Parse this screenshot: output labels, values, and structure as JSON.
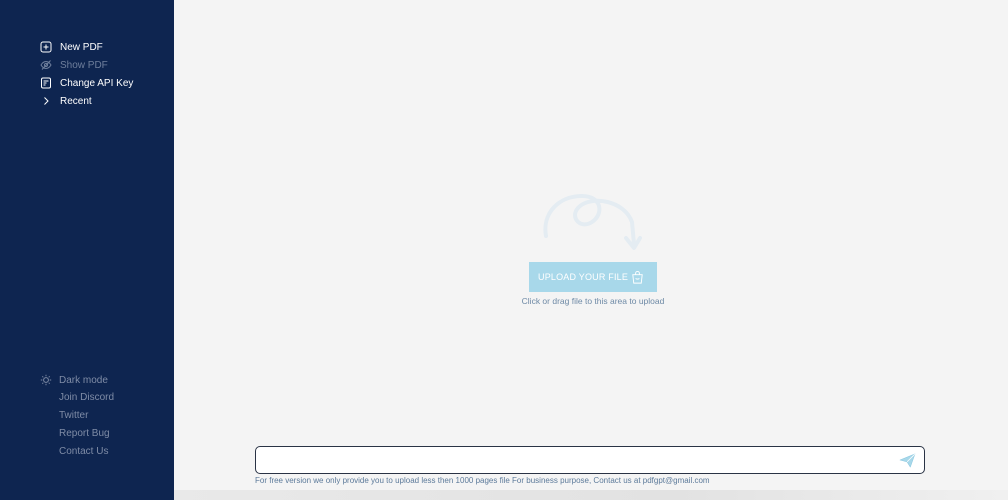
{
  "sidebar": {
    "nav": [
      {
        "label": "New PDF",
        "icon": "plus-square-icon",
        "enabled": true
      },
      {
        "label": "Show PDF",
        "icon": "eye-off-icon",
        "enabled": false
      },
      {
        "label": "Change API Key",
        "icon": "key-doc-icon",
        "enabled": true
      },
      {
        "label": "Recent",
        "icon": "chevron-right-icon",
        "enabled": true
      }
    ],
    "bottom": {
      "dark_mode": "Dark mode",
      "join_discord": "Join Discord",
      "twitter": "Twitter",
      "report_bug": "Report Bug",
      "contact_us": "Contact Us"
    }
  },
  "upload": {
    "button_label": "UPLOAD YOUR FILE",
    "hint": "Click or drag file to this area to upload"
  },
  "chat": {
    "placeholder": "",
    "footer_note": "For free version we only provide you to upload less then 1000 pages file For business purpose, Contact us at pdfgpt@gmail.com"
  },
  "colors": {
    "sidebar_bg": "#0e2550",
    "main_bg": "#f4f4f4",
    "accent": "#a8d8ea"
  }
}
